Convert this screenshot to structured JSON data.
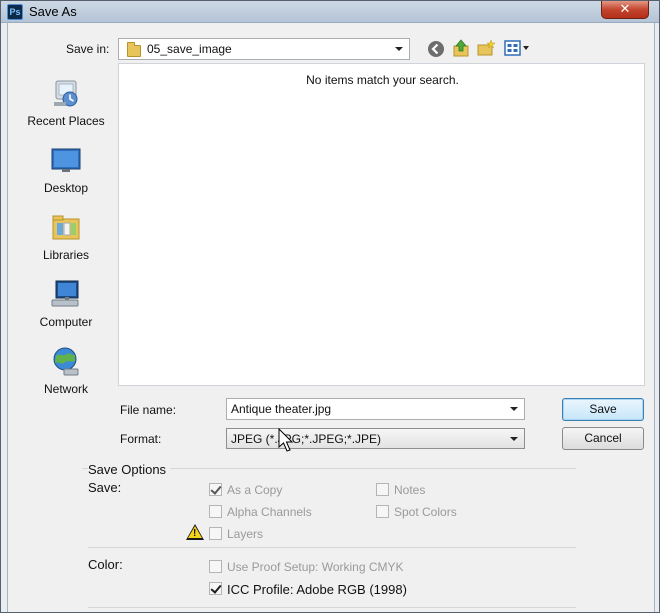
{
  "window": {
    "title": "Save As",
    "app_icon_text": "Ps",
    "close_glyph": "✕"
  },
  "toolbar": {
    "save_in_label": "Save in:",
    "current_folder": "05_save_image",
    "icons": [
      "back-icon",
      "up-folder-icon",
      "new-folder-icon",
      "view-menu-icon"
    ]
  },
  "places": [
    {
      "label": "Recent Places",
      "icon": "recent-places-icon"
    },
    {
      "label": "Desktop",
      "icon": "desktop-icon"
    },
    {
      "label": "Libraries",
      "icon": "libraries-icon"
    },
    {
      "label": "Computer",
      "icon": "computer-icon"
    },
    {
      "label": "Network",
      "icon": "network-icon"
    }
  ],
  "filelist": {
    "empty_message": "No items match your search."
  },
  "form": {
    "file_name_label": "File name:",
    "file_name_value": "Antique theater.jpg",
    "format_label": "Format:",
    "format_value": "JPEG (*.JPG;*.JPEG;*.JPE)",
    "save_button": "Save",
    "cancel_button": "Cancel"
  },
  "save_options": {
    "group_title": "Save Options",
    "save_label": "Save:",
    "as_copy": {
      "label": "As a Copy",
      "checked": true,
      "enabled": false
    },
    "notes": {
      "label": "Notes",
      "checked": false,
      "enabled": false
    },
    "alpha_channels": {
      "label": "Alpha Channels",
      "checked": false,
      "enabled": false
    },
    "spot_colors": {
      "label": "Spot Colors",
      "checked": false,
      "enabled": false
    },
    "layers": {
      "label": "Layers",
      "checked": false,
      "enabled": false
    },
    "color_label": "Color:",
    "use_proof_setup": {
      "label": "Use Proof Setup:  Working CMYK",
      "checked": false,
      "enabled": false
    },
    "icc_profile": {
      "label": "ICC Profile:  Adobe RGB (1998)",
      "checked": true,
      "enabled": true
    }
  },
  "colors": {
    "titlebar": "#b4c4d6",
    "close": "#c3432b",
    "default_button": "#c7e6fa"
  }
}
